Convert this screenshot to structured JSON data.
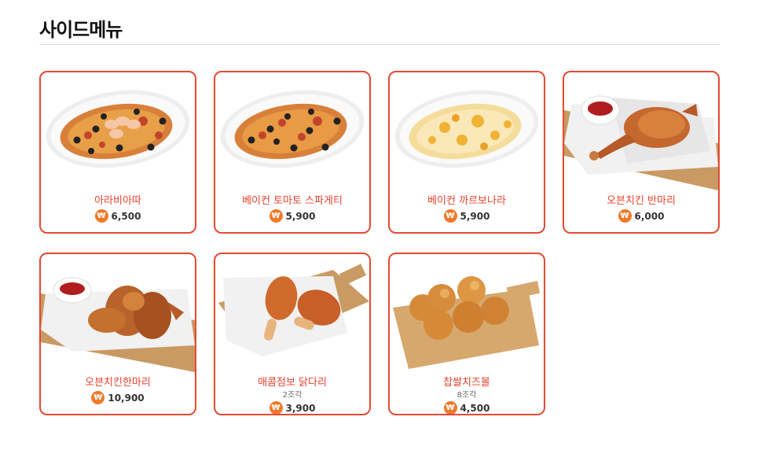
{
  "section": {
    "title": "사이드메뉴"
  },
  "items": [
    {
      "name": "아라비아따",
      "price": "6,500",
      "icon": "arrabbiata-pasta-image"
    },
    {
      "name": "베이컨 토마토 스파게티",
      "price": "5,900",
      "icon": "bacon-tomato-spaghetti-image"
    },
    {
      "name": "베이컨 까르보나라",
      "price": "5,900",
      "icon": "bacon-carbonara-image"
    },
    {
      "name": "오븐치킨 반마리",
      "price": "6,000",
      "icon": "half-oven-chicken-image"
    },
    {
      "name": "오븐치킨한마리",
      "price": "10,900",
      "icon": "whole-oven-chicken-image"
    },
    {
      "name": "매콤점보 닭다리",
      "sub": "2조각",
      "price": "3,900",
      "icon": "spicy-jumbo-drumstick-image"
    },
    {
      "name": "찹쌀치즈볼",
      "sub": "8조각",
      "price": "4,500",
      "icon": "rice-cheese-ball-image"
    }
  ],
  "currency_symbol": "₩",
  "colors": {
    "accent": "#e34a33",
    "name_text": "#e8412c",
    "won_badge": "#f07a2a"
  }
}
